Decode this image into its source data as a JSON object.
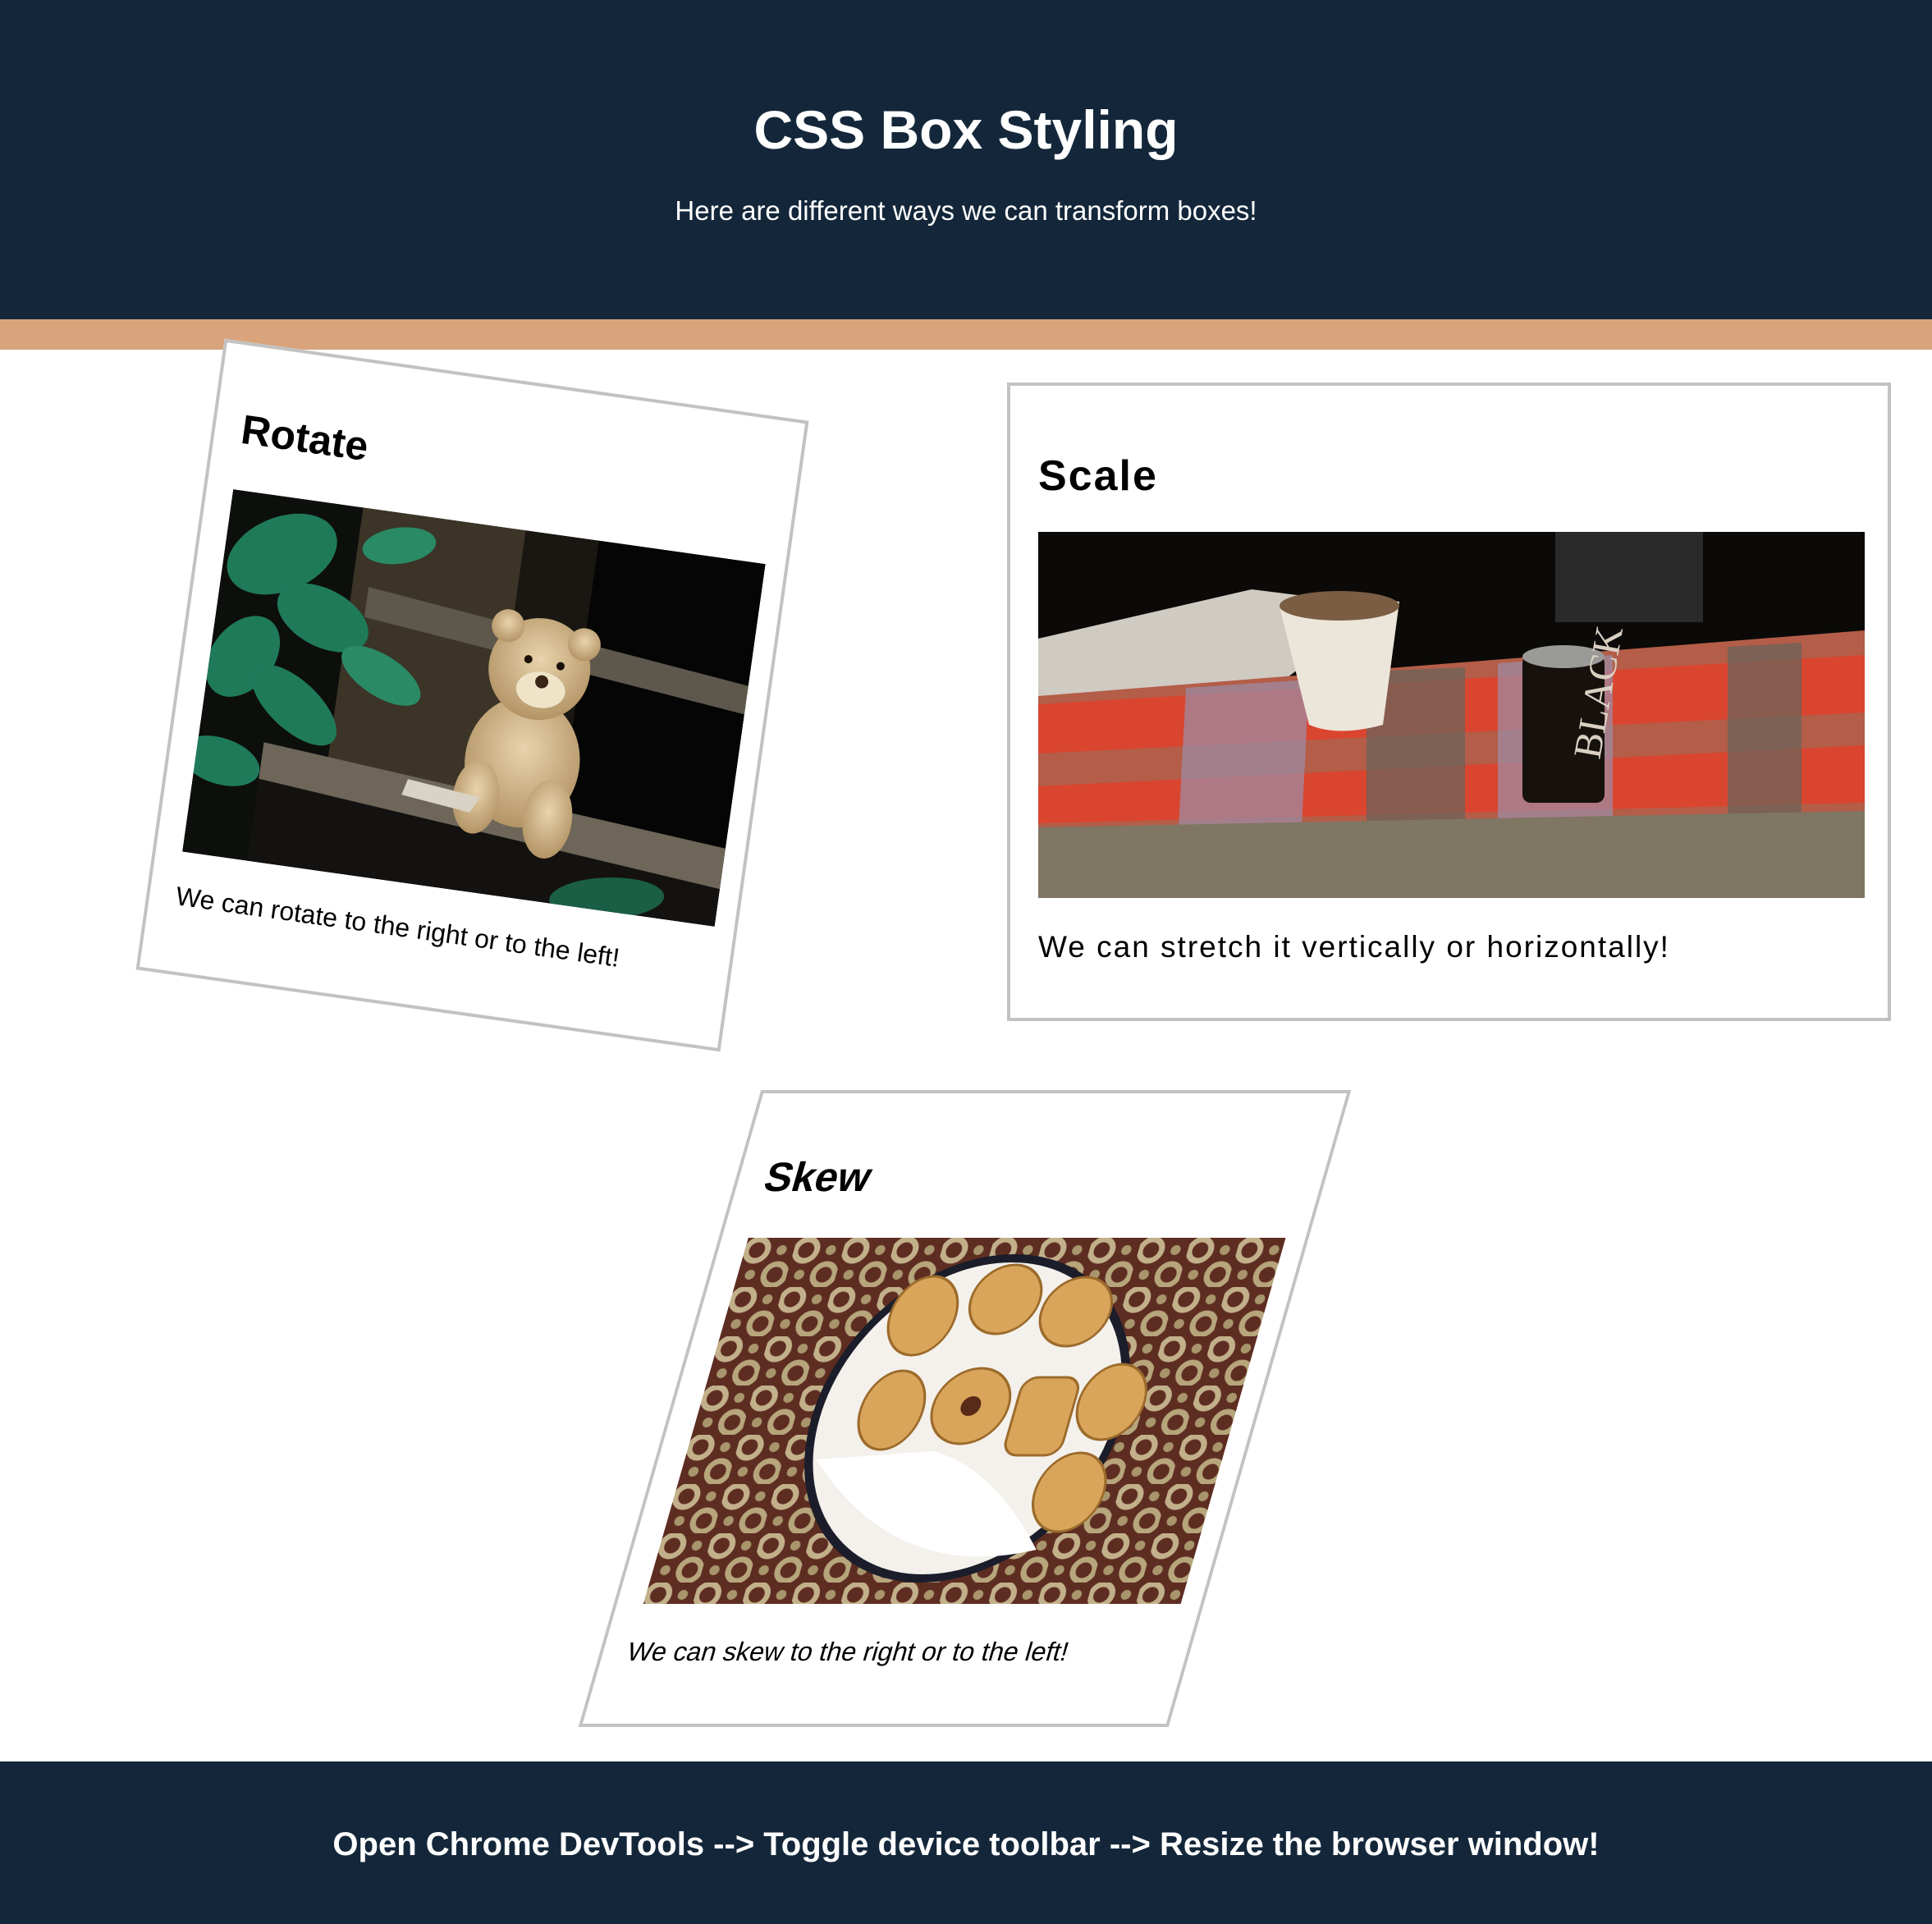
{
  "header": {
    "title": "CSS Box Styling",
    "subtitle": "Here are different ways we can transform boxes!"
  },
  "cards": [
    {
      "title": "Rotate",
      "caption": "We can rotate to the right or to the left!",
      "image": "teddy-bear-photo"
    },
    {
      "title": "Scale",
      "caption": "We can stretch it vertically or horizontally!",
      "image": "coffee-cup-photo"
    },
    {
      "title": "Skew",
      "caption": "We can skew to the right or to the left!",
      "image": "butter-cookies-photo"
    }
  ],
  "footer": {
    "text": "Open Chrome DevTools --> Toggle device toolbar --> Resize the browser window!"
  },
  "colors": {
    "header_bg": "#14273a",
    "accent_stripe": "#d9a47c",
    "card_border": "#c2c2c2"
  }
}
